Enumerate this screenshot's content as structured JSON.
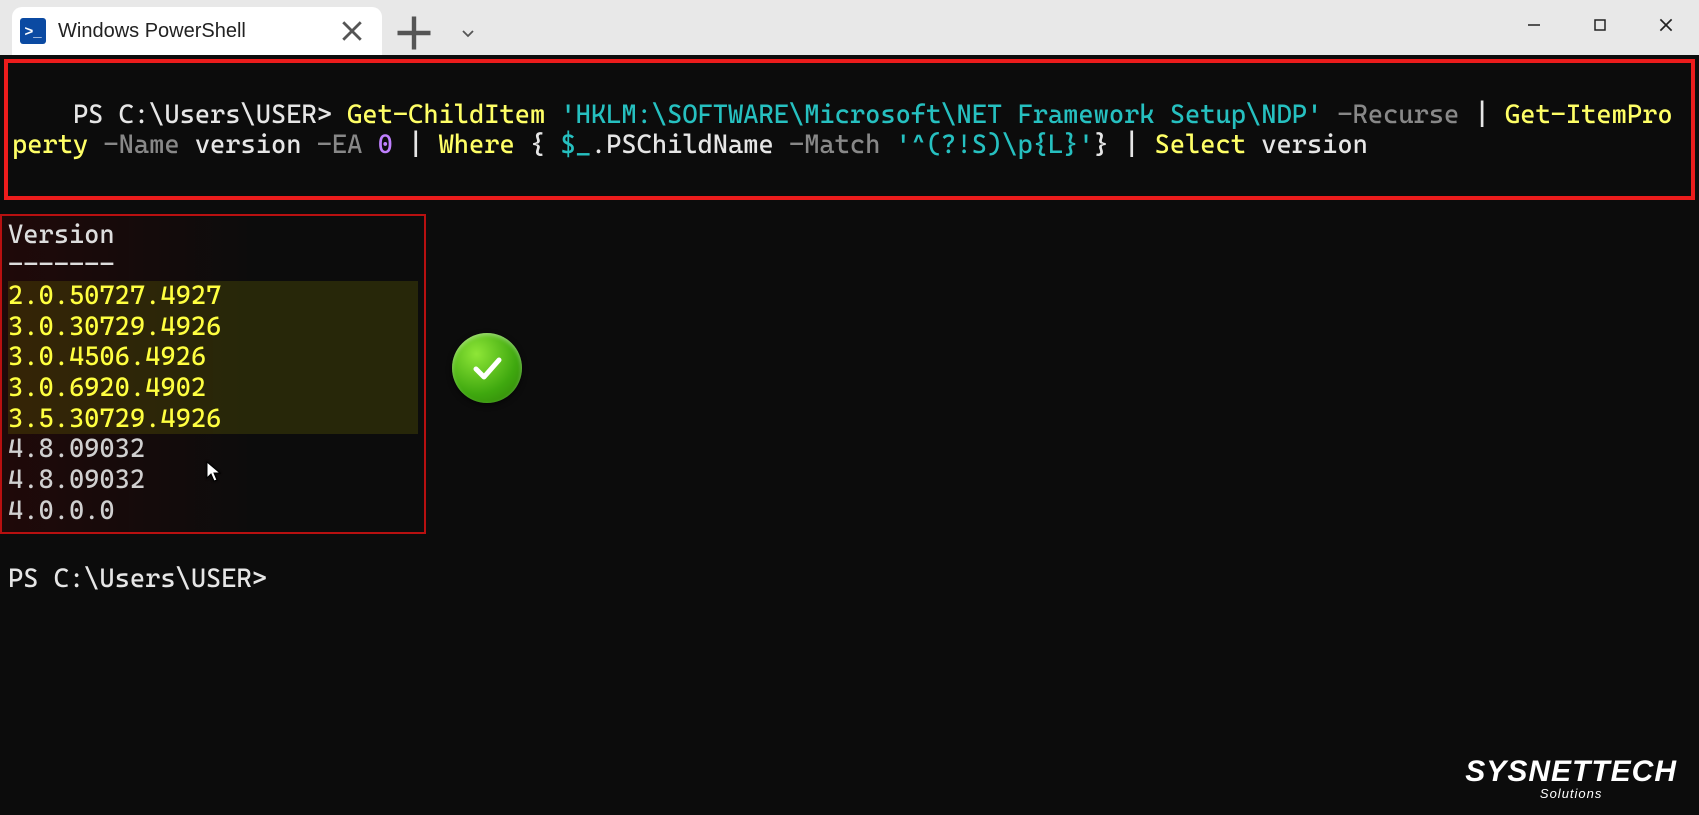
{
  "window": {
    "tab_title": "Windows PowerShell",
    "tab_icon_text": ">_"
  },
  "command": {
    "prompt": "PS C:\\Users\\USER> ",
    "tokens": [
      {
        "t": "Get-ChildItem",
        "c": "yellow"
      },
      {
        "t": " ",
        "c": "white"
      },
      {
        "t": "'HKLM:\\SOFTWARE\\Microsoft\\NET Framework Setup\\NDP'",
        "c": "teal"
      },
      {
        "t": " ",
        "c": "white"
      },
      {
        "t": "-Recurse",
        "c": "gray"
      },
      {
        "t": " | ",
        "c": "white"
      },
      {
        "t": "Get-ItemProperty",
        "c": "yellow"
      },
      {
        "t": " ",
        "c": "white"
      },
      {
        "t": "-Name",
        "c": "gray"
      },
      {
        "t": " version ",
        "c": "white"
      },
      {
        "t": "-EA",
        "c": "gray"
      },
      {
        "t": " ",
        "c": "white"
      },
      {
        "t": "0",
        "c": "purple"
      },
      {
        "t": " | ",
        "c": "white"
      },
      {
        "t": "Where",
        "c": "yellow"
      },
      {
        "t": " { ",
        "c": "white"
      },
      {
        "t": "$_",
        "c": "teal"
      },
      {
        "t": ".PSChildName ",
        "c": "white"
      },
      {
        "t": "-Match",
        "c": "gray"
      },
      {
        "t": " ",
        "c": "white"
      },
      {
        "t": "'^(?!S)\\p{L}'",
        "c": "teal"
      },
      {
        "t": "} | ",
        "c": "white"
      },
      {
        "t": "Select",
        "c": "yellow"
      },
      {
        "t": " version",
        "c": "white"
      }
    ]
  },
  "output": {
    "header": "Version",
    "divider": "-------",
    "rows": [
      {
        "v": "2.0.50727.4927",
        "hl": true
      },
      {
        "v": "3.0.30729.4926",
        "hl": true
      },
      {
        "v": "3.0.4506.4926",
        "hl": true
      },
      {
        "v": "3.0.6920.4902",
        "hl": true
      },
      {
        "v": "3.5.30729.4926",
        "hl": true
      },
      {
        "v": "4.8.09032",
        "hl": false
      },
      {
        "v": "4.8.09032",
        "hl": false
      },
      {
        "v": "4.0.0.0",
        "hl": false
      }
    ]
  },
  "prompt2": "PS C:\\Users\\USER>",
  "watermark": {
    "line1": "SYSNETTECH",
    "line2": "Solutions"
  }
}
